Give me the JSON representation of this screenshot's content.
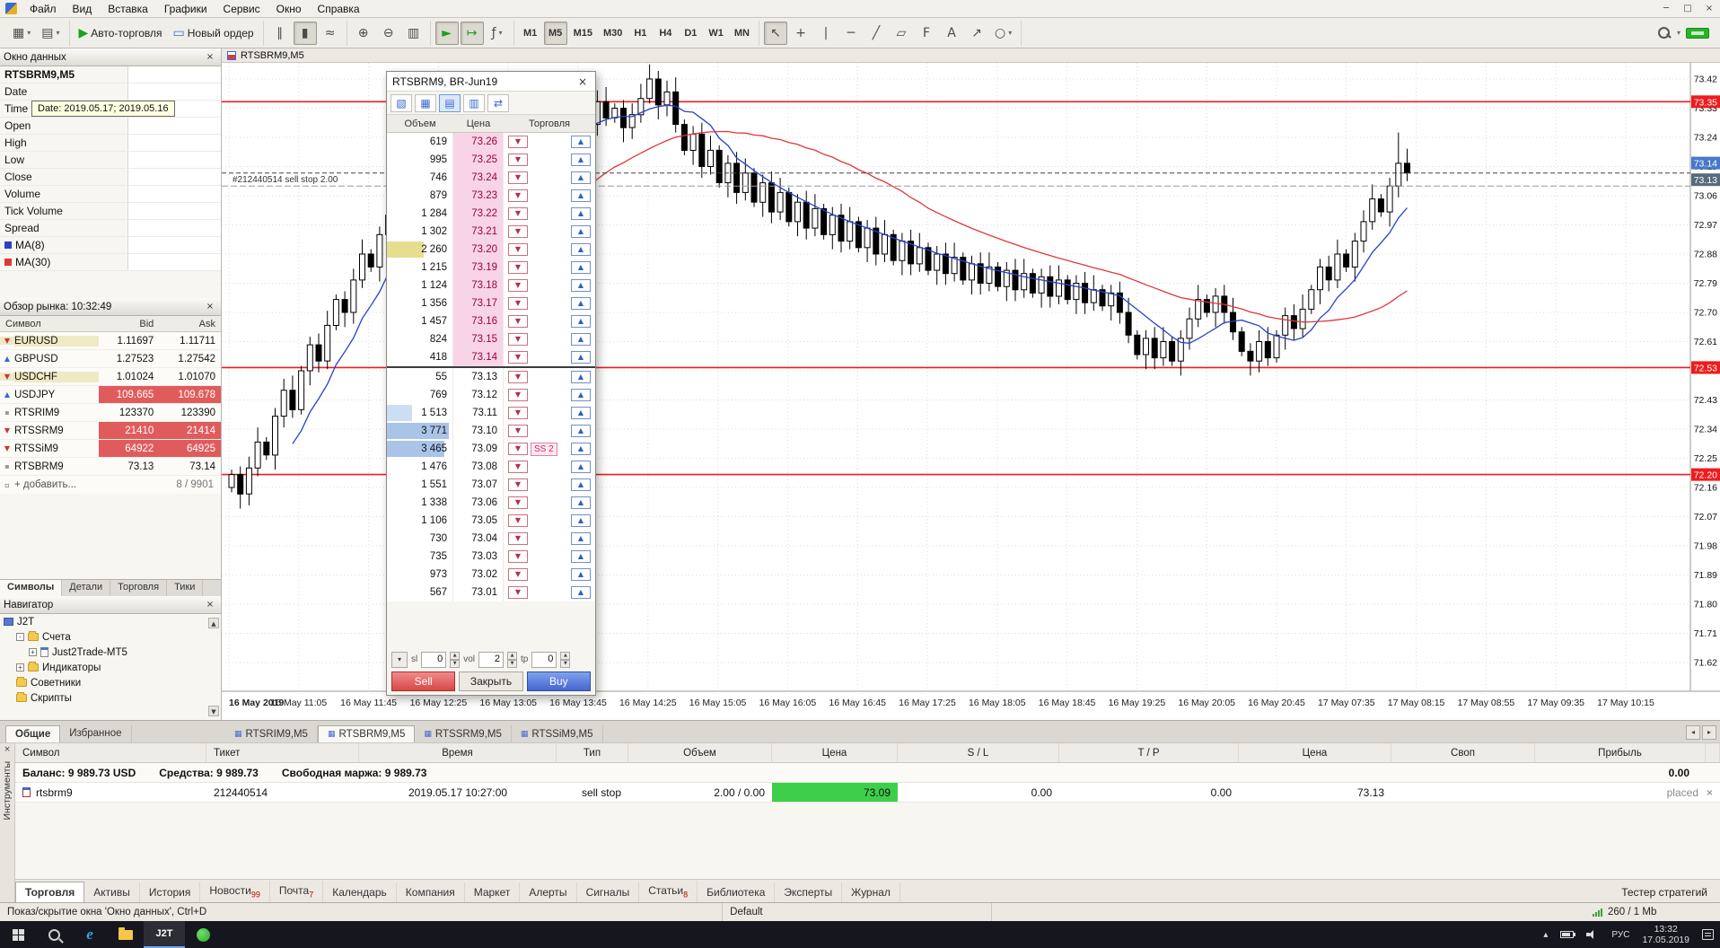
{
  "window": {
    "controls": {
      "minimize": "─",
      "maximize": "□",
      "close": "×"
    }
  },
  "menu": {
    "items": [
      "Файл",
      "Вид",
      "Вставка",
      "Графики",
      "Сервис",
      "Окно",
      "Справка"
    ]
  },
  "toolbar": {
    "groups": [
      {
        "items": [
          {
            "name": "new-chart",
            "glyph": "▦",
            "caret": true
          },
          {
            "name": "profiles",
            "glyph": "▤",
            "caret": true
          }
        ]
      },
      {
        "items": [
          {
            "name": "auto-trading",
            "glyph": "▶",
            "glyph_color": "#1da11d",
            "label": "Авто-торговля"
          },
          {
            "name": "new-order",
            "glyph": "▭",
            "glyph_color": "#3a6ad4",
            "label": "Новый ордер"
          }
        ]
      },
      {
        "items": [
          {
            "name": "chart-bars",
            "glyph": "∥"
          },
          {
            "name": "chart-candles",
            "glyph": "▮",
            "pressed": true
          },
          {
            "name": "chart-line",
            "glyph": "≈"
          }
        ]
      },
      {
        "items": [
          {
            "name": "zoom-in",
            "glyph": "⊕"
          },
          {
            "name": "zoom-out",
            "glyph": "⊖"
          },
          {
            "name": "tile-windows",
            "glyph": "▥"
          }
        ]
      },
      {
        "items": [
          {
            "name": "auto-scroll",
            "glyph": "►",
            "glyph_color": "#1da11d",
            "pressed": true
          },
          {
            "name": "chart-shift",
            "glyph": "↦",
            "glyph_color": "#1da11d",
            "pressed": true
          },
          {
            "name": "indicators",
            "glyph": "ƒ",
            "caret": true
          }
        ]
      },
      {
        "items": [
          {
            "name": "tf-m1",
            "text": "M1"
          },
          {
            "name": "tf-m5",
            "text": "M5",
            "pressed": true
          },
          {
            "name": "tf-m15",
            "text": "M15"
          },
          {
            "name": "tf-m30",
            "text": "M30"
          },
          {
            "name": "tf-h1",
            "text": "H1"
          },
          {
            "name": "tf-h4",
            "text": "H4"
          },
          {
            "name": "tf-d1",
            "text": "D1"
          },
          {
            "name": "tf-w1",
            "text": "W1"
          },
          {
            "name": "tf-mn",
            "text": "MN"
          }
        ]
      },
      {
        "items": [
          {
            "name": "cursor",
            "glyph": "↖",
            "pressed": true
          },
          {
            "name": "crosshair",
            "glyph": "+"
          },
          {
            "name": "vertical-line",
            "glyph": "|"
          },
          {
            "name": "horizontal-line",
            "glyph": "─"
          },
          {
            "name": "trendline",
            "glyph": "╱"
          },
          {
            "name": "channel",
            "glyph": "▱"
          },
          {
            "name": "fibonacci",
            "glyph": "F"
          },
          {
            "name": "text-tool",
            "glyph": "A"
          },
          {
            "name": "arrow-tool",
            "glyph": "↗"
          },
          {
            "name": "shapes",
            "glyph": "○",
            "caret": true
          }
        ]
      }
    ]
  },
  "data_window": {
    "title": "Окно данных",
    "symbol_row": "RTSBRM9,M5",
    "rows": [
      {
        "label": "Date",
        "value": ""
      },
      {
        "label": "Time",
        "value": ""
      },
      {
        "label": "Open",
        "value": ""
      },
      {
        "label": "High",
        "value": ""
      },
      {
        "label": "Low",
        "value": ""
      },
      {
        "label": "Close",
        "value": ""
      },
      {
        "label": "Volume",
        "value": ""
      },
      {
        "label": "Tick Volume",
        "value": ""
      },
      {
        "label": "Spread",
        "value": ""
      },
      {
        "label": "MA(8)",
        "value": "",
        "chip": "#2743c8"
      },
      {
        "label": "MA(30)",
        "value": "",
        "chip": "#e03838"
      }
    ]
  },
  "tooltip": {
    "text": "Date: 2019.05.17; 2019.05.16"
  },
  "market_watch": {
    "title": "Обзор рынка: 10:32:49",
    "columns": [
      "Символ",
      "Bid",
      "Ask"
    ],
    "rows": [
      {
        "symbol": "EURUSD",
        "bid": "1.11697",
        "ask": "1.11711",
        "icon": "down",
        "sym_bg": "#efe9c4"
      },
      {
        "symbol": "GBPUSD",
        "bid": "1.27523",
        "ask": "1.27542",
        "icon": "up"
      },
      {
        "symbol": "USDCHF",
        "bid": "1.01024",
        "ask": "1.01070",
        "icon": "down",
        "sym_bg": "#efe9c4"
      },
      {
        "symbol": "USDJPY",
        "bid": "109.665",
        "ask": "109.678",
        "icon": "up",
        "price_bg": "#e05c5c",
        "price_fg": "#ffffff"
      },
      {
        "symbol": "RTSRIM9",
        "bid": "123370",
        "ask": "123390",
        "icon": "dot"
      },
      {
        "symbol": "RTSSRM9",
        "bid": "21410",
        "ask": "21414",
        "icon": "down",
        "price_bg": "#e05c5c",
        "price_fg": "#ffffff"
      },
      {
        "symbol": "RTSSiM9",
        "bid": "64922",
        "ask": "64925",
        "icon": "down",
        "price_bg": "#e05c5c",
        "price_fg": "#ffffff"
      },
      {
        "symbol": "RTSBRM9",
        "bid": "73.13",
        "ask": "73.14",
        "icon": "dot"
      }
    ],
    "add_row": "+ добавить...",
    "counter": "8 / 9901",
    "tabs": [
      "Символы",
      "Детали",
      "Торговля",
      "Тики"
    ],
    "active_tab": 0
  },
  "navigator": {
    "title": "Навигатор",
    "tree": [
      {
        "label": "J2T",
        "indent": 0,
        "icon": "network"
      },
      {
        "label": "Счета",
        "indent": 1,
        "expander": "-",
        "icon": "folder"
      },
      {
        "label": "Just2Trade-MT5",
        "indent": 2,
        "expander": "+",
        "icon": "account"
      },
      {
        "label": "Индикаторы",
        "indent": 1,
        "expander": "+",
        "icon": "folder"
      },
      {
        "label": "Советники",
        "indent": 1,
        "icon": "folder"
      },
      {
        "label": "Скрипты",
        "indent": 1,
        "icon": "folder"
      }
    ],
    "tabs": [
      "Общие",
      "Избранное"
    ],
    "active_tab": 0
  },
  "chart": {
    "title": "RTSBRM9,M5"
  },
  "chart_data": {
    "type": "candlestick",
    "symbol": "RTSBRM9,M5",
    "closes": [
      72.2,
      72.14,
      72.22,
      72.3,
      72.26,
      72.38,
      72.46,
      72.4,
      72.52,
      72.6,
      72.55,
      72.66,
      72.74,
      72.7,
      72.8,
      72.88,
      72.84,
      72.94,
      73.0,
      72.95,
      73.02,
      72.97,
      73.05,
      73.1,
      73.04,
      73.12,
      73.08,
      73.15,
      73.2,
      73.14,
      73.22,
      73.17,
      73.24,
      73.19,
      73.26,
      73.21,
      73.28,
      73.24,
      73.32,
      73.26,
      73.33,
      73.28,
      73.35,
      73.3,
      73.33,
      73.27,
      73.31,
      73.36,
      73.42,
      73.34,
      73.38,
      73.28,
      73.2,
      73.25,
      73.15,
      73.2,
      73.1,
      73.16,
      73.07,
      73.13,
      73.04,
      73.1,
      73.01,
      73.07,
      72.98,
      73.04,
      72.96,
      73.02,
      72.94,
      73.0,
      72.92,
      72.98,
      72.9,
      72.96,
      72.88,
      72.94,
      72.86,
      72.92,
      72.85,
      72.9,
      72.83,
      72.88,
      72.82,
      72.87,
      72.8,
      72.85,
      72.79,
      72.84,
      72.78,
      72.83,
      72.77,
      72.82,
      72.76,
      72.81,
      72.75,
      72.8,
      72.74,
      72.79,
      72.73,
      72.77,
      72.72,
      72.76,
      72.7,
      72.63,
      72.57,
      72.62,
      72.56,
      72.61,
      72.55,
      72.62,
      72.68,
      72.74,
      72.7,
      72.75,
      72.7,
      72.64,
      72.58,
      72.55,
      72.61,
      72.56,
      72.63,
      72.69,
      72.65,
      72.71,
      72.77,
      72.84,
      72.8,
      72.88,
      72.84,
      72.92,
      72.98,
      73.05,
      73.01,
      73.09,
      73.16,
      73.13
    ],
    "wick_boost": {
      "48": 0.03,
      "134": 0.06
    },
    "price_ticks": [
      73.42,
      73.33,
      73.24,
      73.15,
      73.06,
      72.97,
      72.88,
      72.79,
      72.7,
      72.61,
      72.52,
      72.43,
      72.34,
      72.25,
      72.16,
      72.07,
      71.98,
      71.89,
      71.8,
      71.71,
      71.62
    ],
    "time_labels": [
      "16 May 2019",
      "16 May 11:05",
      "16 May 11:45",
      "16 May 12:25",
      "16 May 13:05",
      "16 May 13:45",
      "16 May 14:25",
      "16 May 15:05",
      "16 May 16:05",
      "16 May 16:45",
      "16 May 17:25",
      "16 May 18:05",
      "16 May 18:45",
      "16 May 19:25",
      "16 May 20:05",
      "16 May 20:45",
      "17 May 07:35",
      "17 May 08:15",
      "17 May 08:55",
      "17 May 09:35",
      "17 May 10:15"
    ],
    "hlines": [
      {
        "price": 73.35,
        "color": "#ee1c1c"
      },
      {
        "price": 72.53,
        "color": "#ee1c1c"
      },
      {
        "price": 72.2,
        "color": "#ee1c1c"
      }
    ],
    "bid": 73.13,
    "ask": 73.14,
    "order": {
      "price": 73.09,
      "label": "#212440514 sell stop 2.00"
    },
    "ma_fast": {
      "period": 8,
      "color": "#2743c8"
    },
    "ma_slow": {
      "period": 30,
      "color": "#e03838"
    },
    "ylim": [
      71.62,
      73.42
    ],
    "grid": true
  },
  "dom": {
    "title": "RTSBRM9, BR-Jun19",
    "icons": [
      {
        "name": "dom-chart-view",
        "glyph": "▧"
      },
      {
        "name": "dom-table-view",
        "glyph": "▦"
      },
      {
        "name": "dom-depth-view",
        "glyph": "▤",
        "selected": true
      },
      {
        "name": "dom-onclick-view",
        "glyph": "▥"
      },
      {
        "name": "dom-transfer",
        "glyph": "⇄"
      }
    ],
    "columns": [
      "Объем",
      "Цена",
      "Торговля"
    ],
    "asks": [
      {
        "volume": "619",
        "price": "73.26"
      },
      {
        "volume": "995",
        "price": "73.25"
      },
      {
        "volume": "746",
        "price": "73.24"
      },
      {
        "volume": "879",
        "price": "73.23"
      },
      {
        "volume": "1 284",
        "price": "73.22"
      },
      {
        "volume": "1 302",
        "price": "73.21"
      },
      {
        "volume": "2 260",
        "price": "73.20",
        "bar": "#e6dd8e"
      },
      {
        "volume": "1 215",
        "price": "73.19"
      },
      {
        "volume": "1 124",
        "price": "73.18"
      },
      {
        "volume": "1 356",
        "price": "73.17"
      },
      {
        "volume": "1 457",
        "price": "73.16"
      },
      {
        "volume": "824",
        "price": "73.15"
      },
      {
        "volume": "418",
        "price": "73.14"
      }
    ],
    "bids": [
      {
        "volume": "55",
        "price": "73.13"
      },
      {
        "volume": "769",
        "price": "73.12"
      },
      {
        "volume": "1 513",
        "price": "73.11",
        "bar": "#cdddf3"
      },
      {
        "volume": "3 771",
        "price": "73.10",
        "bar": "#a9c4e8"
      },
      {
        "volume": "3 465",
        "price": "73.09",
        "bar": "#a9c4e8",
        "badge": "SS 2"
      },
      {
        "volume": "1 476",
        "price": "73.08"
      },
      {
        "volume": "1 551",
        "price": "73.07"
      },
      {
        "volume": "1 338",
        "price": "73.06"
      },
      {
        "volume": "1 106",
        "price": "73.05"
      },
      {
        "volume": "730",
        "price": "73.04"
      },
      {
        "volume": "735",
        "price": "73.03"
      },
      {
        "volume": "973",
        "price": "73.02"
      },
      {
        "volume": "567",
        "price": "73.01"
      }
    ],
    "spinners": [
      {
        "label": "sl",
        "value": "0"
      },
      {
        "label": "vol",
        "value": "2"
      },
      {
        "label": "tp",
        "value": "0"
      }
    ],
    "sell_label": "Sell",
    "close_label": "Закрыть",
    "buy_label": "Buy"
  },
  "chart_tabs": {
    "items": [
      "RTSRIM9,M5",
      "RTSBRM9,M5",
      "RTSSRM9,M5",
      "RTSSiM9,M5"
    ],
    "active": 1
  },
  "toolbox": {
    "vertical_label": "Инструменты",
    "headers": [
      "Символ",
      "Тикет",
      "Время",
      "Тип",
      "Объем",
      "Цена",
      "S / L",
      "T / P",
      "Цена",
      "Своп",
      "Прибыль",
      ""
    ],
    "balance": [
      "Баланс: 9 989.73 USD",
      "Средства: 9 989.73",
      "Свободная маржа: 9 989.73"
    ],
    "balance_profit": "0.00",
    "order": {
      "symbol": "rtsbrm9",
      "ticket": "212440514",
      "time": "2019.05.17 10:27:00",
      "type": "sell stop",
      "volume": "2.00 / 0.00",
      "price": "73.09",
      "sl": "0.00",
      "tp": "0.00",
      "price2": "73.13",
      "swap": "",
      "profit": "placed",
      "close": "×"
    },
    "tabs": [
      {
        "label": "Торговля",
        "active": true
      },
      {
        "label": "Активы"
      },
      {
        "label": "История"
      },
      {
        "label": "Новости",
        "badge": "99"
      },
      {
        "label": "Почта",
        "badge": "7"
      },
      {
        "label": "Календарь"
      },
      {
        "label": "Компания"
      },
      {
        "label": "Маркет"
      },
      {
        "label": "Алерты"
      },
      {
        "label": "Сигналы"
      },
      {
        "label": "Статьи",
        "badge": "8"
      },
      {
        "label": "Библиотека"
      },
      {
        "label": "Эксперты"
      },
      {
        "label": "Журнал"
      }
    ],
    "tester_label": "Тестер стратегий"
  },
  "status": {
    "help": "Показ/скрытие окна 'Окно данных', Ctrl+D",
    "profile": "Default",
    "traffic": "260 / 1 Mb"
  },
  "taskbar": {
    "j2t_label": "J2T",
    "lang": "РУС",
    "time": "13:32",
    "date": "17.05.2019"
  }
}
